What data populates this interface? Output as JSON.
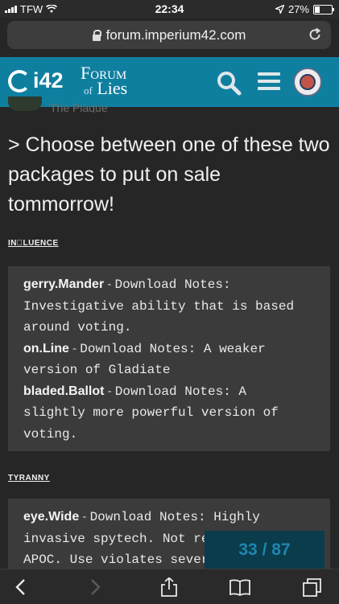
{
  "status_bar": {
    "carrier": "TFW",
    "time": "22:34",
    "battery": "27%"
  },
  "url_bar": {
    "url": "forum.imperium42.com"
  },
  "header": {
    "logo_text": "i42",
    "title_line1": "Forum",
    "title_of": "of",
    "title_line2": "Lies"
  },
  "previous_post": {
    "author": "The Plague"
  },
  "post": {
    "heading": "> Choose between one of these two packages to put on sale tommorrow!",
    "sections": [
      {
        "label": "IN⃞LUENCE",
        "items": [
          {
            "name": "gerry.Mander",
            "sep": " - ",
            "notes": "Download Notes: Investigative ability that is based around voting."
          },
          {
            "name": "on.Line",
            "sep": " - ",
            "notes": "Download Notes: A weaker version of Gladiate"
          },
          {
            "name": "bladed.Ballot",
            "sep": " - ",
            "notes": "Download Notes: A slightly more powerful version of voting."
          }
        ]
      },
      {
        "label": "TYRANNY",
        "items": [
          {
            "name": "eye.Wide",
            "sep": " - ",
            "notes": "Download Notes: Highly invasive spytech. Not recommended for APOC. Use violates several"
          }
        ]
      }
    ]
  },
  "page_counter": {
    "current": "33",
    "separator": " / ",
    "total": "87"
  },
  "colors": {
    "header_bg": "#0f7fa0",
    "page_bg": "#262626",
    "box_bg": "#3b3b3b",
    "counter_bg": "#0a3c4b",
    "counter_text": "#1e86b0"
  }
}
